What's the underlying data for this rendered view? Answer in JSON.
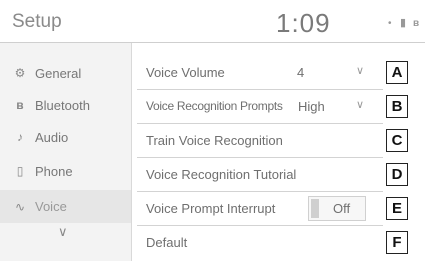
{
  "header": {
    "title": "Setup",
    "time": "1:09",
    "status_icons": [
      "signal-icon",
      "battery-icon",
      "bluetooth-icon"
    ],
    "signal_glyph": "•",
    "battery_glyph": "▮",
    "bt_glyph": "ʙ"
  },
  "sidebar": {
    "items": [
      {
        "label": "General",
        "icon": "gear-icon",
        "glyph": "⚙"
      },
      {
        "label": "Bluetooth",
        "icon": "bluetooth-icon",
        "glyph": "ʙ"
      },
      {
        "label": "Audio",
        "icon": "music-note-icon",
        "glyph": "♪"
      },
      {
        "label": "Phone",
        "icon": "phone-icon",
        "glyph": "▯"
      },
      {
        "label": "Voice",
        "icon": "voice-icon",
        "glyph": "∿"
      }
    ],
    "more_icon": "chevron-down-icon",
    "more_glyph": "∨"
  },
  "settings": [
    {
      "label": "Voice Volume",
      "value": "4",
      "has_dropdown": true,
      "tag": "A"
    },
    {
      "label": "Voice Recognition Prompts",
      "value": "High",
      "has_dropdown": true,
      "tag": "B"
    },
    {
      "label": "Train Voice Recognition",
      "tag": "C"
    },
    {
      "label": "Voice Recognition Tutorial",
      "tag": "D"
    },
    {
      "label": "Voice Prompt Interrupt",
      "toggle_value": "Off",
      "tag": "E"
    },
    {
      "label": "Default",
      "tag": "F"
    }
  ],
  "dropdown_glyph": "∨"
}
